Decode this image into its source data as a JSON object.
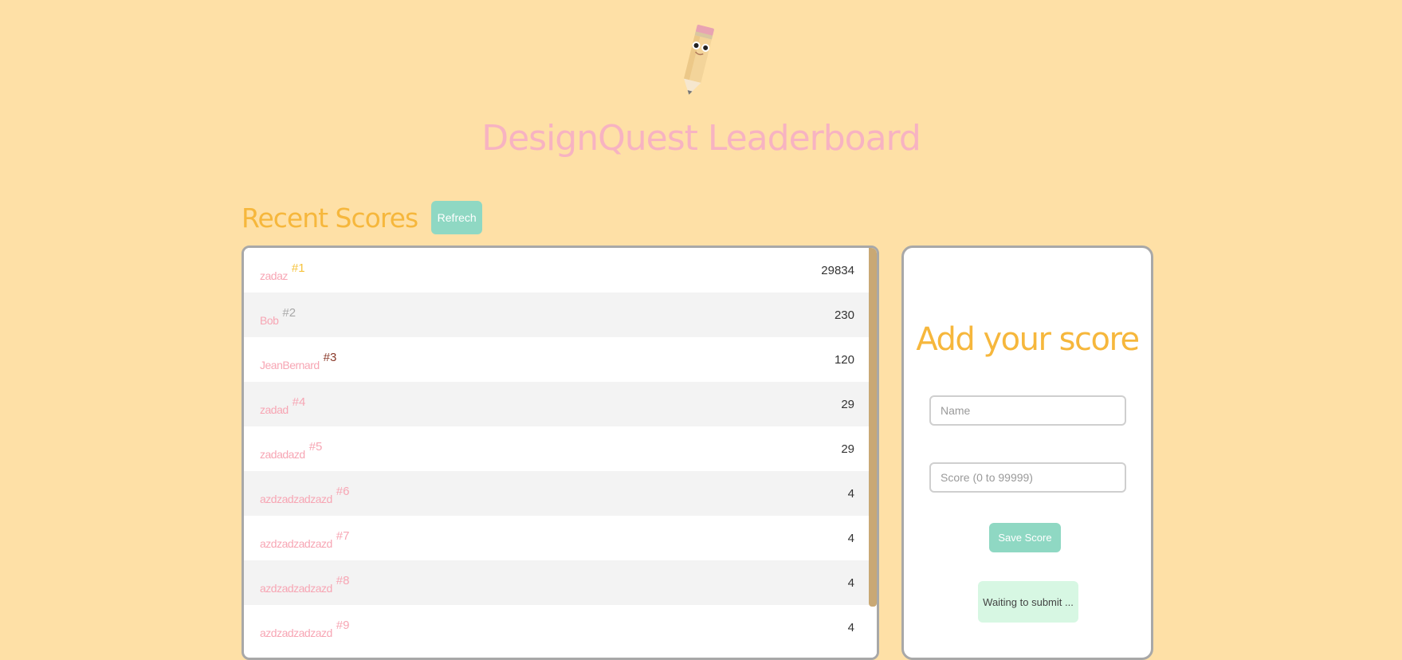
{
  "header": {
    "logo_icon": "pencil-mascot-icon",
    "title": "DesignQuest Leaderboard"
  },
  "recent_scores": {
    "title": "Recent Scores",
    "refresh_label": "Refrech",
    "rows": [
      {
        "name": "zadaz",
        "rank": "#1",
        "score": "29834"
      },
      {
        "name": "Bob",
        "rank": "#2",
        "score": "230"
      },
      {
        "name": "JeanBernard",
        "rank": "#3",
        "score": "120"
      },
      {
        "name": "zadad",
        "rank": "#4",
        "score": "29"
      },
      {
        "name": "zadadazd",
        "rank": "#5",
        "score": "29"
      },
      {
        "name": "azdzadzadzazd",
        "rank": "#6",
        "score": "4"
      },
      {
        "name": "azdzadzadzazd",
        "rank": "#7",
        "score": "4"
      },
      {
        "name": "azdzadzadzazd",
        "rank": "#8",
        "score": "4"
      },
      {
        "name": "azdzadzadzazd",
        "rank": "#9",
        "score": "4"
      }
    ]
  },
  "add_score": {
    "title": "Add your score",
    "name_placeholder": "Name",
    "score_placeholder": "Score (0 to 99999)",
    "save_label": "Save Score",
    "status": "Waiting to submit ..."
  },
  "colors": {
    "background": "#fee0a6",
    "title_pink": "#f7b3c2",
    "accent_yellow": "#f6b73c",
    "button_mint": "#8fd8c3",
    "status_bg": "#d7f7e3"
  }
}
